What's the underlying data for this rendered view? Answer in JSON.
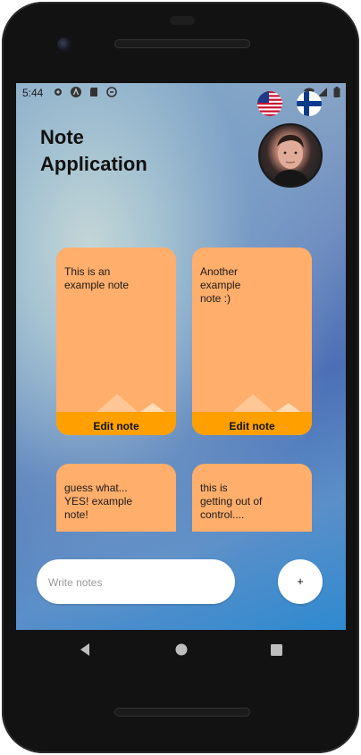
{
  "status_bar": {
    "time": "5:44",
    "icons": [
      "settings-icon",
      "a-badge-icon",
      "sd-card-icon",
      "sync-icon",
      "wifi-icon",
      "signal-icon",
      "battery-icon"
    ]
  },
  "header": {
    "title_line1": "Note",
    "title_line2": "Application"
  },
  "language_flags": [
    "us-flag-icon",
    "finland-flag-icon"
  ],
  "notes": [
    {
      "text": "This is an\nexample note",
      "edit_label": "Edit note"
    },
    {
      "text": "Another\nexample\nnote :)",
      "edit_label": "Edit note"
    },
    {
      "text": "guess what...\nYES! example\nnote!"
    },
    {
      "text": "this is\ngetting out of\ncontrol...."
    }
  ],
  "composer": {
    "placeholder": "Write notes",
    "add_label": "+"
  },
  "nav_bar": [
    "back-icon",
    "home-icon",
    "recents-icon"
  ],
  "colors": {
    "note_bg": "#ffae6b",
    "edit_button": "#ffa000",
    "background_gradient": [
      "#a7c4d2",
      "#4c6fb5",
      "#2e8ad0"
    ]
  }
}
